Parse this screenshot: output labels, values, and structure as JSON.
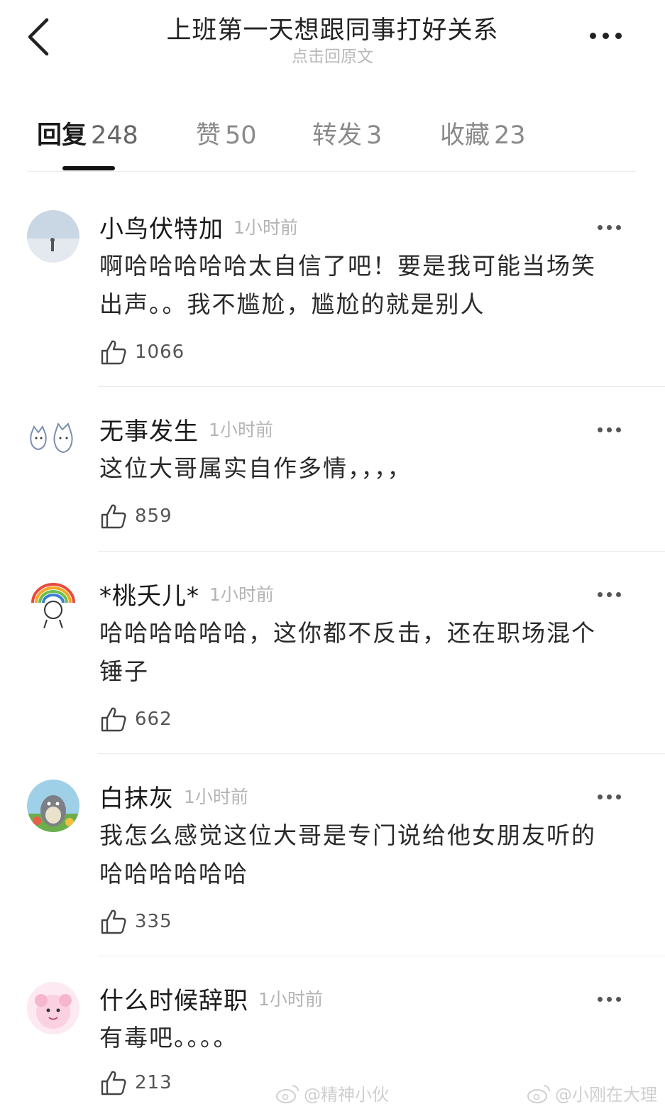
{
  "header": {
    "title": "上班第一天想跟同事打好关系",
    "subtitle": "点击回原文"
  },
  "tabs": [
    {
      "label": "回复",
      "count": "248",
      "active": true
    },
    {
      "label": "赞",
      "count": "50",
      "active": false
    },
    {
      "label": "转发",
      "count": "3",
      "active": false
    },
    {
      "label": "收藏",
      "count": "23",
      "active": false
    }
  ],
  "comments": [
    {
      "name": "小鸟伏特加",
      "time": "1小时前",
      "text": "啊哈哈哈哈哈太自信了吧！要是我可能当场笑出声。。我不尴尬，尴尬的就是别人",
      "likes": "1066",
      "avatar": "seascape-photo-avatar"
    },
    {
      "name": "无事发生",
      "time": "1小时前",
      "text": "这位大哥属实自作多情，，，，",
      "likes": "859",
      "avatar": "cartoon-cats-avatar"
    },
    {
      "name": "*桃夭儿*",
      "time": "1小时前",
      "text": "哈哈哈哈哈哈，这你都不反击，还在职场混个锤子",
      "likes": "662",
      "avatar": "rainbow-doodle-avatar"
    },
    {
      "name": "白抹灰",
      "time": "1小时前",
      "text": "我怎么感觉这位大哥是专门说给他女朋友听的哈哈哈哈哈哈",
      "likes": "335",
      "avatar": "totoro-avatar"
    },
    {
      "name": "什么时候辞职",
      "time": "1小时前",
      "text": "有毒吧。。。。",
      "likes": "213",
      "avatar": "pink-character-avatar"
    }
  ],
  "watermarks": [
    "@精神小伙",
    "@小刚在大理"
  ],
  "colors": {
    "text": "#1a1a1a",
    "muted": "#b4b4b4",
    "divider": "#ebebeb",
    "indicator": "#111111"
  }
}
